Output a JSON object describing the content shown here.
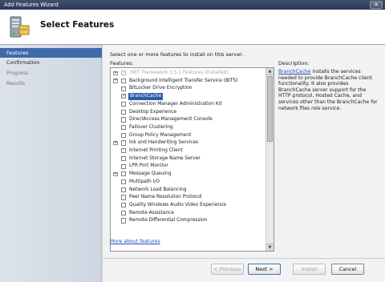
{
  "window": {
    "title": "Add Features Wizard",
    "close_glyph": "✕"
  },
  "header": {
    "title": "Select Features",
    "icon": "server-features-icon"
  },
  "nav": [
    {
      "label": "Features",
      "state": "active"
    },
    {
      "label": "Confirmation",
      "state": "normal"
    },
    {
      "label": "Progress",
      "state": "disabled"
    },
    {
      "label": "Results",
      "state": "disabled"
    }
  ],
  "main": {
    "instruction": "Select one or more features to install on this server.",
    "features_label": "Features:",
    "description_label": "Description:",
    "description_link": "BranchCache",
    "description_rest": " installs the services needed to provide BranchCache client functionality. It also provides BranchCache server support for the HTTP protocol, Hosted Cache, and services other than the BranchCache for network files role service.",
    "more_link": "More about features"
  },
  "features": [
    {
      "label": ".NET Framework 3.5.1 Features  (Installed)",
      "expander": "+",
      "checked": true,
      "dim": true
    },
    {
      "label": "Background Intelligent Transfer Service (BITS)",
      "expander": "+",
      "checked": false
    },
    {
      "label": "BitLocker Drive Encryption",
      "expander": "",
      "checked": false
    },
    {
      "label": "BranchCache",
      "expander": "",
      "checked": true,
      "selected": true
    },
    {
      "label": "Connection Manager Administration Kit",
      "expander": "",
      "checked": false
    },
    {
      "label": "Desktop Experience",
      "expander": "",
      "checked": false
    },
    {
      "label": "DirectAccess Management Console",
      "expander": "",
      "checked": false
    },
    {
      "label": "Failover Clustering",
      "expander": "",
      "checked": false
    },
    {
      "label": "Group Policy Management",
      "expander": "",
      "checked": false
    },
    {
      "label": "Ink and Handwriting Services",
      "expander": "+",
      "checked": false
    },
    {
      "label": "Internet Printing Client",
      "expander": "",
      "checked": false
    },
    {
      "label": "Internet Storage Name Server",
      "expander": "",
      "checked": false
    },
    {
      "label": "LPR Port Monitor",
      "expander": "",
      "checked": false
    },
    {
      "label": "Message Queuing",
      "expander": "+",
      "checked": false
    },
    {
      "label": "Multipath I/O",
      "expander": "",
      "checked": false
    },
    {
      "label": "Network Load Balancing",
      "expander": "",
      "checked": false
    },
    {
      "label": "Peer Name Resolution Protocol",
      "expander": "",
      "checked": false
    },
    {
      "label": "Quality Windows Audio Video Experience",
      "expander": "",
      "checked": false
    },
    {
      "label": "Remote Assistance",
      "expander": "",
      "checked": false
    },
    {
      "label": "Remote Differential Compression",
      "expander": "",
      "checked": false
    }
  ],
  "buttons": {
    "previous": "< Previous",
    "next": "Next >",
    "install": "Install",
    "cancel": "Cancel"
  },
  "scroll": {
    "up": "▲",
    "down": "▼"
  },
  "colors": {
    "accent": "#3e6aa8",
    "link": "#1c4fb5",
    "selection": "#2f5ea8"
  }
}
